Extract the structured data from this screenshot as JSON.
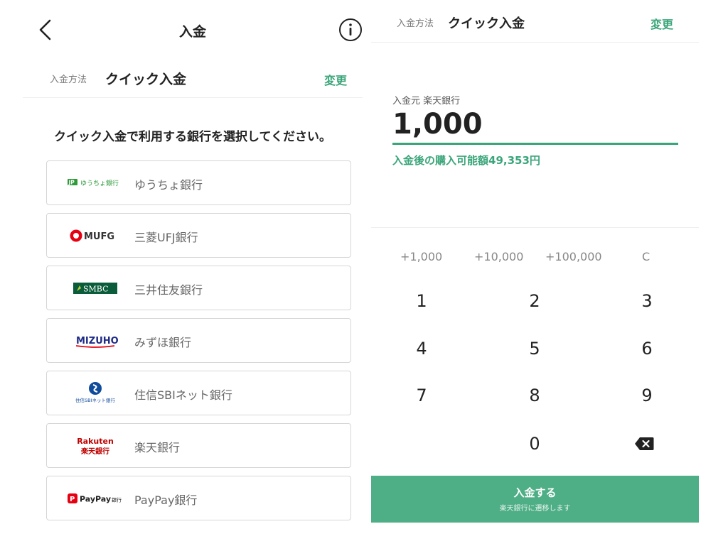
{
  "left": {
    "header": {
      "title": "入金"
    },
    "method": {
      "label": "入金方法",
      "value": "クイック入金",
      "change": "変更"
    },
    "instruction": "クイック入金で利用する銀行を選択してください。",
    "banks": [
      {
        "logo": "yucho-logo",
        "logo_text": "ゆうちょ銀行",
        "name": "ゆうちょ銀行"
      },
      {
        "logo": "mufg-logo",
        "logo_text": "MUFG",
        "name": "三菱UFJ銀行"
      },
      {
        "logo": "smbc-logo",
        "logo_text": "SMBC",
        "name": "三井住友銀行"
      },
      {
        "logo": "mizuho-logo",
        "logo_text": "MIZUHO",
        "name": "みずほ銀行"
      },
      {
        "logo": "sbi-logo",
        "logo_text": "住信SBIネット銀行",
        "name": "住信SBIネット銀行"
      },
      {
        "logo": "rakuten-logo",
        "logo_text": "Rakuten 楽天銀行",
        "name": "楽天銀行"
      },
      {
        "logo": "paypay-logo",
        "logo_text": "PayPay 銀行",
        "name": "PayPay銀行"
      }
    ]
  },
  "right": {
    "method": {
      "label": "入金方法",
      "value": "クイック入金",
      "change": "変更"
    },
    "source_label": "入金元 楽天銀行",
    "amount": "1,000",
    "after_note": "入金後の購入可能額49,353円",
    "quick_amounts": [
      "+1,000",
      "+10,000",
      "+100,000"
    ],
    "clear": "C",
    "keys": [
      "1",
      "2",
      "3",
      "4",
      "5",
      "6",
      "7",
      "8",
      "9",
      "0"
    ],
    "submit": {
      "label": "入金する",
      "sub": "楽天銀行に遷移します"
    }
  },
  "colors": {
    "accent": "#3aa57a",
    "button": "#4eae85"
  }
}
